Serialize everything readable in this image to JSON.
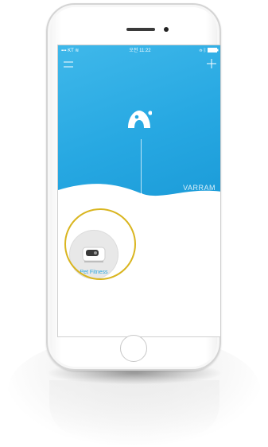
{
  "status_bar": {
    "carrier": "KT",
    "time": "오전 11:22"
  },
  "header": {
    "menu_icon": "hamburger-menu-icon",
    "add_icon": "plus-icon"
  },
  "hero": {
    "logo_icon": "varram-logo-icon",
    "brand": "VARRAM",
    "background_color": "#27a8e2"
  },
  "devices": [
    {
      "label": "Pet Fitness",
      "icon": "pet-fitness-device-icon"
    }
  ],
  "colors": {
    "accent": "#2aa6df",
    "highlight": "#d9b51f"
  }
}
